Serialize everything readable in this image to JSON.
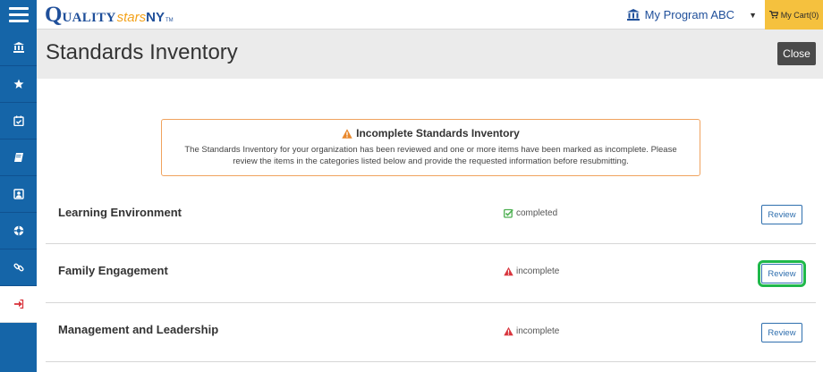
{
  "topbar": {
    "logo": {
      "q": "Q",
      "uality": "UALITY",
      "stars": "stars",
      "ny": "NY",
      "tm": "TM"
    },
    "program_label": "My Program ABC",
    "cart_label": "My Cart(0)"
  },
  "sidebar": {
    "items": [
      {
        "icon": "bank-icon"
      },
      {
        "icon": "star-icon"
      },
      {
        "icon": "calendar-check-icon"
      },
      {
        "icon": "book-icon"
      },
      {
        "icon": "id-card-icon"
      },
      {
        "icon": "life-ring-icon"
      },
      {
        "icon": "link-icon"
      },
      {
        "icon": "sign-out-icon",
        "active": true
      }
    ]
  },
  "header": {
    "title": "Standards Inventory",
    "close_label": "Close"
  },
  "alert": {
    "title": "Incomplete Standards Inventory",
    "body": "The Standards Inventory for your organization has been reviewed and one or more items have been marked as incomplete. Please review the items in the categories listed below and provide the requested information before resubmitting."
  },
  "rows": [
    {
      "title": "Learning Environment",
      "status": "completed",
      "review_label": "Review"
    },
    {
      "title": "Family Engagement",
      "status": "incomplete",
      "review_label": "Review"
    },
    {
      "title": "Management and Leadership",
      "status": "incomplete",
      "review_label": "Review"
    }
  ],
  "colors": {
    "brand_blue": "#1565a8",
    "cart_yellow": "#f5c13e",
    "alert_border": "#f0a35e",
    "completed_green": "#4caf50",
    "incomplete_red": "#d9363e",
    "focus_green": "#1fb84a"
  }
}
